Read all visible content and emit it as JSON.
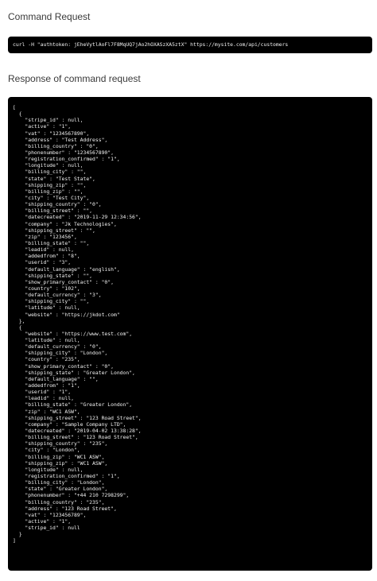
{
  "command_section": {
    "title": "Command Request",
    "command": "curl -H \"authtoken: jEheVytlAoFl7F8MqUQ7jAo2hOXASzXA5ztX\" https://mysite.com/api/customers"
  },
  "response_section": {
    "title": "Response of command request",
    "lines": [
      "[",
      "  {",
      "    \"stripe_id\" : null,",
      "    \"active\" : \"1\",",
      "    \"vat\" : \"1234567890\",",
      "    \"address\" : \"Test Address\",",
      "    \"billing_country\" : \"0\",",
      "    \"phonenumber\" : \"1234567890\",",
      "    \"registration_confirmed\" : \"1\",",
      "    \"longitude\" : null,",
      "    \"billing_city\" : \"\",",
      "    \"state\" : \"Test State\",",
      "    \"shipping_zip\" : \"\",",
      "    \"billing_zip\" : \"\",",
      "    \"city\" : \"Test City\",",
      "    \"shipping_country\" : \"0\",",
      "    \"billing_street\" : \"\",",
      "    \"datecreated\" : \"2019-11-29 12:34:56\",",
      "    \"company\" : \"Jk Technologies\",",
      "    \"shipping_street\" : \"\",",
      "    \"zip\" : \"123456\",",
      "    \"billing_state\" : \"\",",
      "    \"leadid\" : null,",
      "    \"addedfrom\" : \"8\",",
      "    \"userid\" : \"3\",",
      "    \"default_language\" : \"english\",",
      "    \"shipping_state\" : \"\",",
      "    \"show_primary_contact\" : \"0\",",
      "    \"country\" : \"102\",",
      "    \"default_currency\" : \"3\",",
      "    \"shipping_city\" : \"\",",
      "    \"latitude\" : null,",
      "    \"website\" : \"https://jkdot.com\"",
      "  },",
      "  {",
      "    \"website\" : \"https://www.test.com\",",
      "    \"latitude\" : null,",
      "    \"default_currency\" : \"0\",",
      "    \"shipping_city\" : \"London\",",
      "    \"country\" : \"235\",",
      "    \"show_primary_contact\" : \"0\",",
      "    \"shipping_state\" : \"Greater London\",",
      "    \"default_language\" : \"\",",
      "    \"addedfrom\" : \"1\",",
      "    \"userid\" : \"1\",",
      "    \"leadid\" : null,",
      "    \"billing_state\" : \"Greater London\",",
      "    \"zip\" : \"WC1 ASW\",",
      "    \"shipping_street\" : \"123 Road Street\",",
      "    \"company\" : \"Sample Company LTD\",",
      "    \"datecreated\" : \"2019-04-02 13:38:28\",",
      "    \"billing_street\" : \"123 Road Street\",",
      "    \"shipping_country\" : \"235\",",
      "    \"city\" : \"London\",",
      "    \"billing_zip\" : \"WC1 ASW\",",
      "    \"shipping_zip\" : \"WC1 ASW\",",
      "    \"longitude\" : null,",
      "    \"registration_confirmed\" : \"1\",",
      "    \"billing_city\" : \"London\",",
      "    \"state\" : \"Greater London\",",
      "    \"phonenumber\" : \"+44 210 7298299\",",
      "    \"billing_country\" : \"235\",",
      "    \"address\" : \"123 Road Street\",",
      "    \"vat\" : \"123456789\",",
      "    \"active\" : \"1\",",
      "    \"stripe_id\" : null",
      "  }",
      "]"
    ]
  },
  "colors": {
    "code_background": "#000000",
    "code_text": "#f2f2f2",
    "heading_text": "#3a3a3a",
    "page_background": "#ffffff"
  }
}
